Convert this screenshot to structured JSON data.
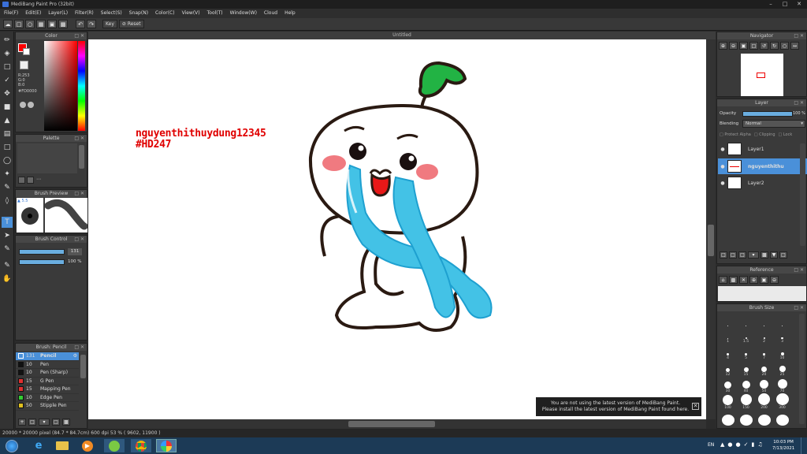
{
  "window": {
    "title": "MediBang Paint Pro (32bit)"
  },
  "menu": [
    "File(F)",
    "Edit(E)",
    "Layer(L)",
    "Filter(R)",
    "Select(S)",
    "Snap(N)",
    "Color(C)",
    "View(V)",
    "Tool(T)",
    "Window(W)",
    "Cloud",
    "Help"
  ],
  "toolbar": {
    "key_label": "Key",
    "reset_label": "Reset"
  },
  "canvas": {
    "title": "Untitled"
  },
  "artwork": {
    "watermark_line1": "nguyenthithuydung12345",
    "watermark_line2": "#HD247"
  },
  "color_panel": {
    "title": "Color",
    "r": "R:253",
    "g": "G:0",
    "b": "B:0",
    "hex": "#FD0000",
    "primary_color": "#fd0000"
  },
  "palette_panel": {
    "title": "Palette"
  },
  "brush_preview": {
    "title": "Brush Preview",
    "size": "5.5"
  },
  "brush_control": {
    "title": "Brush Control",
    "size_value": "131",
    "opacity_value": "100 %"
  },
  "brush_panel": {
    "title": "Brush: Pencil",
    "items": [
      {
        "size": "131",
        "name": "Pencil",
        "color": "#ffffff",
        "selected": true
      },
      {
        "size": "10",
        "name": "Pen",
        "color": "#111111"
      },
      {
        "size": "10",
        "name": "Pen (Sharp)",
        "color": "#111111"
      },
      {
        "size": "15",
        "name": "G Pen",
        "color": "#e03030"
      },
      {
        "size": "15",
        "name": "Mapping Pen",
        "color": "#e03030"
      },
      {
        "size": "10",
        "name": "Edge Pen",
        "color": "#33cc33"
      },
      {
        "size": "50",
        "name": "Stipple Pen",
        "color": "#e0c020"
      }
    ]
  },
  "navigator": {
    "title": "Navigator"
  },
  "layer_panel": {
    "title": "Layer",
    "opacity_label": "Opacity",
    "opacity_value": "100 %",
    "blending_label": "Blending",
    "blending_value": "Normal",
    "protect_alpha": "Protect Alpha",
    "clipping": "Clipping",
    "lock": "Lock",
    "layers": [
      {
        "name": "Layer1",
        "selected": false
      },
      {
        "name": "nguyenthithu",
        "selected": true
      },
      {
        "name": "Layer2",
        "selected": false
      }
    ]
  },
  "reference_panel": {
    "title": "Reference"
  },
  "brush_size_panel": {
    "title": "Brush Size",
    "sizes": [
      "",
      "",
      "",
      "",
      "1",
      "1.5",
      "2",
      "3",
      "4",
      "5",
      "7",
      "10",
      "12",
      "15",
      "20",
      "25",
      "30",
      "40",
      "50",
      "70",
      "100",
      "150",
      "200",
      "300",
      "",
      "",
      "",
      ""
    ]
  },
  "statusbar": {
    "text": "20000 * 20000 pixel  (84.7 * 84.7cm)  600 dpi  53 %  ( 9602, 11900 )"
  },
  "notice": {
    "line1": "You are not using the latest version of MediBang Paint.",
    "line2": "Please install the latest version of MediBang Paint found here."
  },
  "taskbar": {
    "lang": "EN",
    "time": "10:03 PM",
    "date": "7/13/2021"
  }
}
